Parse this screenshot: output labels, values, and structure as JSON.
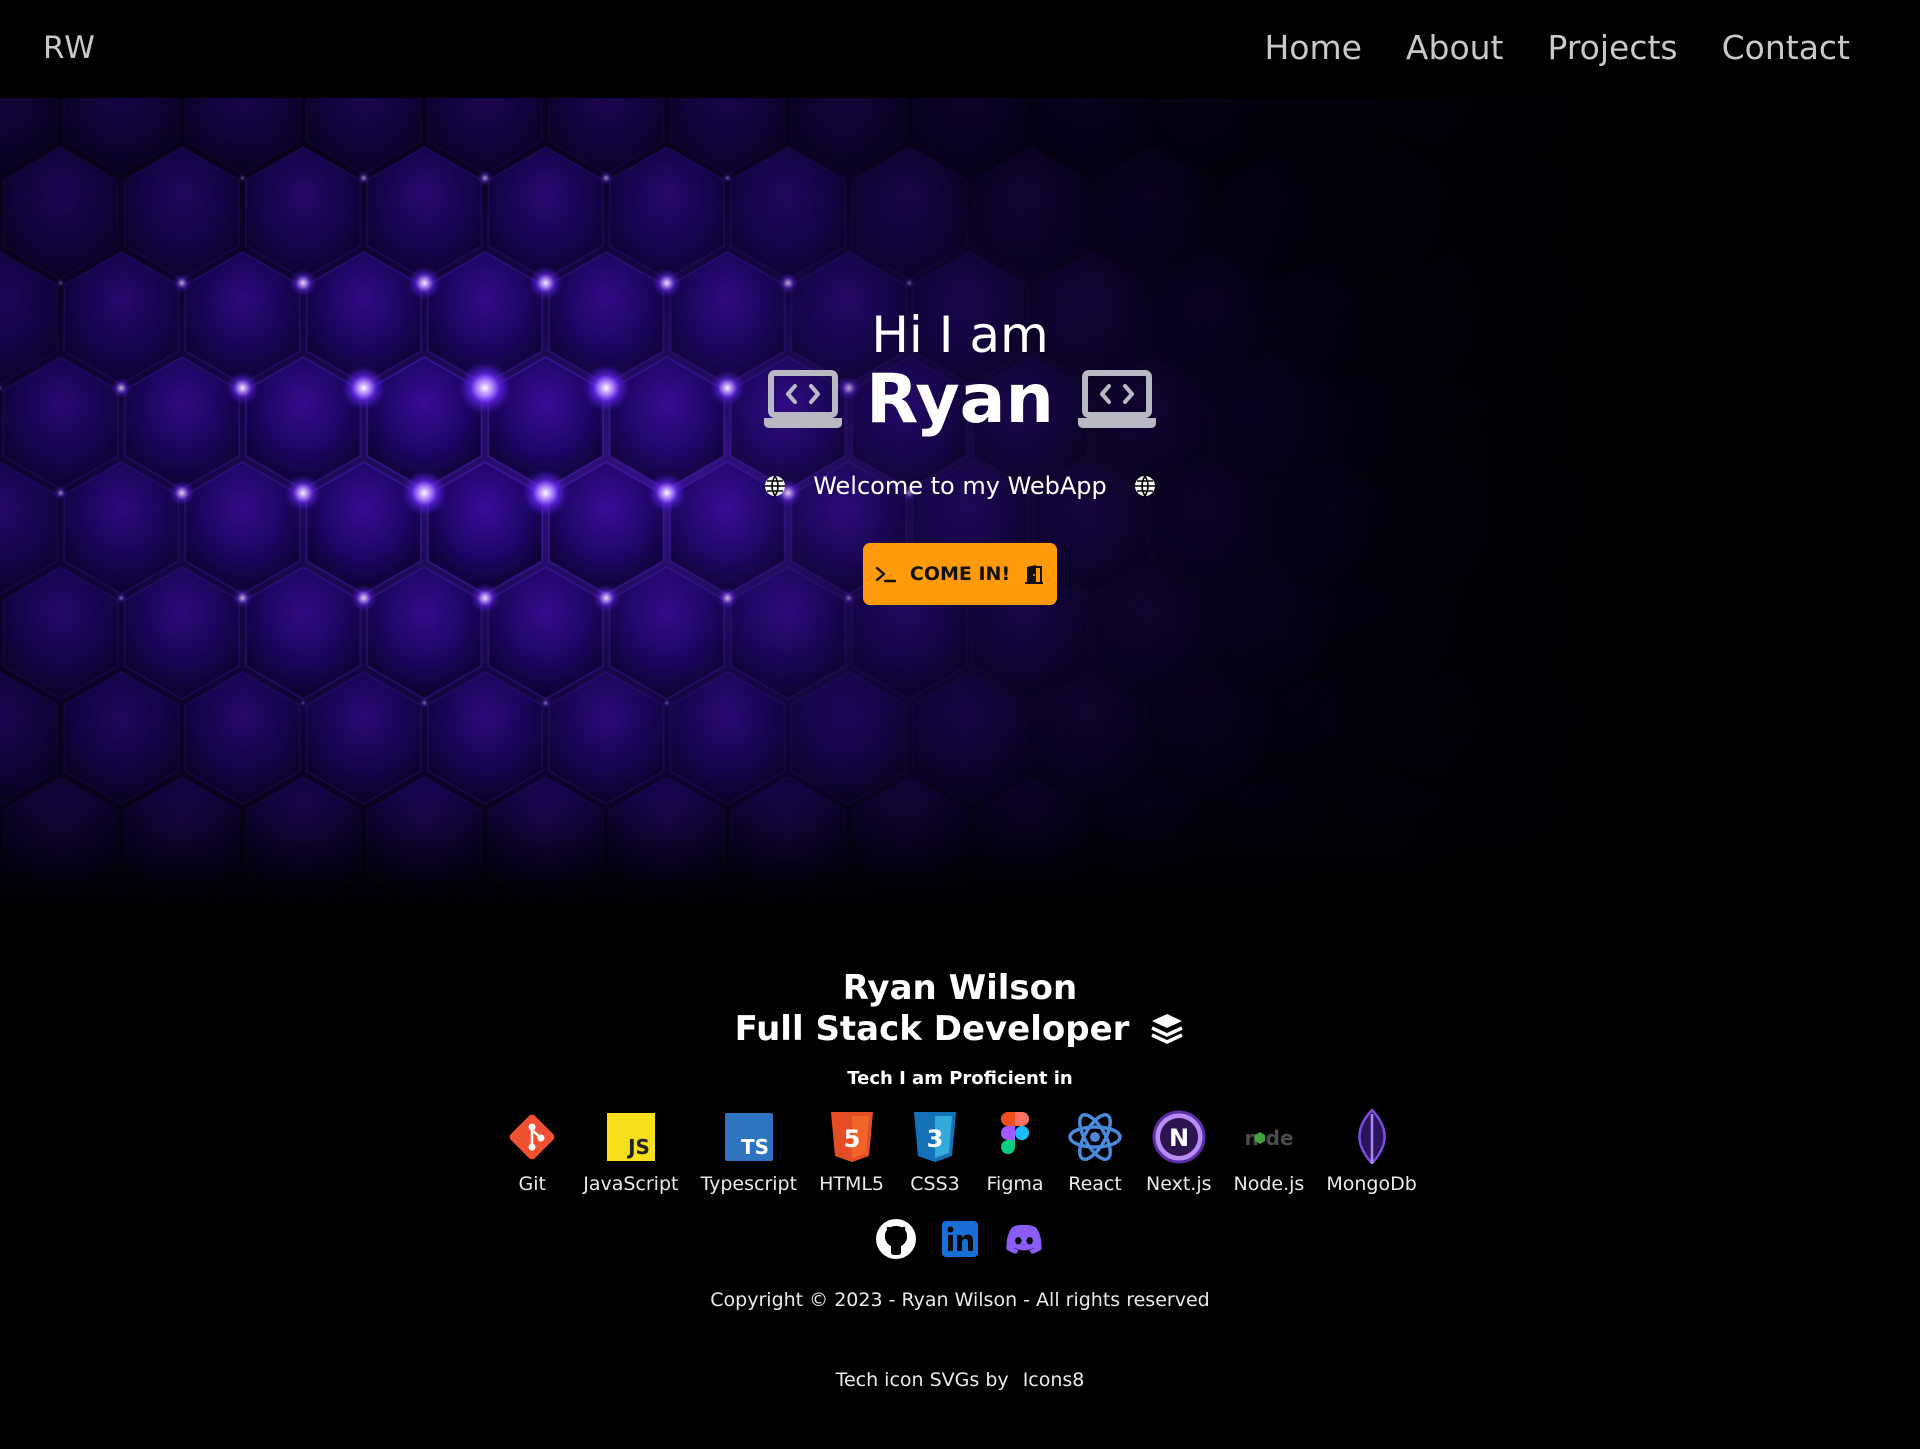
{
  "nav": {
    "logo": "RW",
    "links": [
      "Home",
      "About",
      "Projects",
      "Contact"
    ]
  },
  "hero": {
    "greeting": "Hi I am",
    "name": "Ryan",
    "welcome": "Welcome to my WebApp",
    "cta_label": "COME IN!",
    "icons": [
      "laptop-code-icon",
      "globe-icon",
      "terminal-icon",
      "door-open-icon"
    ]
  },
  "footer": {
    "full_name": "Ryan Wilson",
    "role": "Full Stack Developer",
    "tech_title": "Tech I am Proficient in",
    "tech": [
      {
        "label": "Git",
        "icon": "git-icon"
      },
      {
        "label": "JavaScript",
        "icon": "javascript-icon"
      },
      {
        "label": "Typescript",
        "icon": "typescript-icon"
      },
      {
        "label": "HTML5",
        "icon": "html5-icon"
      },
      {
        "label": "CSS3",
        "icon": "css3-icon"
      },
      {
        "label": "Figma",
        "icon": "figma-icon"
      },
      {
        "label": "React",
        "icon": "react-icon"
      },
      {
        "label": "Next.js",
        "icon": "nextjs-icon"
      },
      {
        "label": "Node.js",
        "icon": "nodejs-icon"
      },
      {
        "label": "MongoDb",
        "icon": "mongodb-icon"
      }
    ],
    "socials": [
      "github-icon",
      "linkedin-icon",
      "discord-icon"
    ],
    "copyright": "Copyright © 2023 - Ryan Wilson - All rights reserved",
    "credit_text": "Tech icon SVGs by",
    "credit_link": "Icons8"
  },
  "colors": {
    "accent": "#ff9a0a",
    "hero_glow": "#5b1fd6",
    "nav_text": "#c8c8cc",
    "background": "#000000"
  }
}
